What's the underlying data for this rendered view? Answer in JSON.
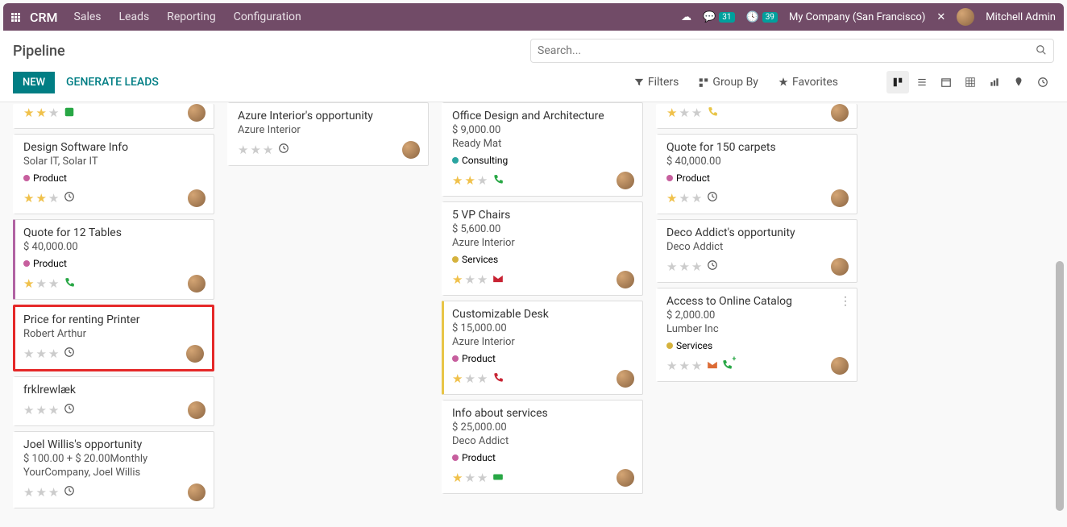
{
  "topbar": {
    "brand": "CRM",
    "menu": [
      "Sales",
      "Leads",
      "Reporting",
      "Configuration"
    ],
    "messages_badge": "31",
    "activity_badge": "39",
    "company": "My Company (San Francisco)",
    "user": "Mitchell Admin"
  },
  "header": {
    "title": "Pipeline",
    "search_placeholder": "Search..."
  },
  "toolbar": {
    "new_label": "NEW",
    "generate_label": "GENERATE LEADS",
    "filters": "Filters",
    "groupby": "Group By",
    "favorites": "Favorites"
  },
  "tag_colors": {
    "product": "#c75f9e",
    "consulting": "#2aa4a0",
    "services": "#d5b23d"
  },
  "columns": [
    {
      "cards": [
        {
          "partial_top": true,
          "stars": 2,
          "activity": "done-green"
        },
        {
          "title": "Design Software Info",
          "subtitle": "Solar IT, Solar IT",
          "tag": "Product",
          "tag_color": "product",
          "stars": 2,
          "activity": "clock"
        },
        {
          "title": "Quote for 12 Tables",
          "amount": "$ 40,000.00",
          "tag": "Product",
          "tag_color": "product",
          "stars": 1,
          "activity": "phone",
          "bar": "#b163a3"
        },
        {
          "title": "Price for renting Printer",
          "subtitle": "Robert Arthur",
          "stars": 0,
          "activity": "clock",
          "highlight": true
        },
        {
          "title": "frklrewlæk",
          "stars": 0,
          "activity": "clock"
        },
        {
          "title": "Joel Willis's opportunity",
          "amount": "$ 100.00 + $ 20.00Monthly",
          "subtitle": "YourCompany, Joel Willis",
          "stars": 0,
          "activity": "clock"
        }
      ]
    },
    {
      "cards": [
        {
          "title": "Azure Interior's opportunity",
          "subtitle": "Azure Interior",
          "stars": 0,
          "activity": "clock"
        }
      ]
    },
    {
      "cards": [
        {
          "title": "Office Design and Architecture",
          "amount": "$ 9,000.00",
          "subtitle": "Ready Mat",
          "tag": "Consulting",
          "tag_color": "consulting",
          "stars": 2,
          "activity": "phone"
        },
        {
          "title": "5 VP Chairs",
          "amount": "$ 5,600.00",
          "subtitle": "Azure Interior",
          "tag": "Services",
          "tag_color": "services",
          "stars": 1,
          "activity": "mail-red"
        },
        {
          "title": "Customizable Desk",
          "amount": "$ 15,000.00",
          "subtitle": "Azure Interior",
          "tag": "Product",
          "tag_color": "product",
          "stars": 1,
          "activity": "phone-red",
          "bar": "#e8c547"
        },
        {
          "title": "Info about services",
          "amount": "$ 25,000.00",
          "subtitle": "Deco Addict",
          "tag": "Product",
          "tag_color": "product",
          "stars": 1,
          "activity": "card-green"
        }
      ]
    },
    {
      "cards": [
        {
          "partial_top": true,
          "stars": 1,
          "activity": "warn"
        },
        {
          "title": "Quote for 150 carpets",
          "amount": "$ 40,000.00",
          "tag": "Product",
          "tag_color": "product",
          "stars": 1,
          "activity": "clock"
        },
        {
          "title": "Deco Addict's opportunity",
          "subtitle": "Deco Addict",
          "stars": 0,
          "activity": "clock"
        },
        {
          "title": "Access to Online Catalog",
          "amount": "$ 2,000.00",
          "subtitle": "Lumber Inc",
          "tag": "Services",
          "tag_color": "services",
          "stars": 0,
          "activity": "mail-plus",
          "menu": true
        }
      ]
    }
  ]
}
